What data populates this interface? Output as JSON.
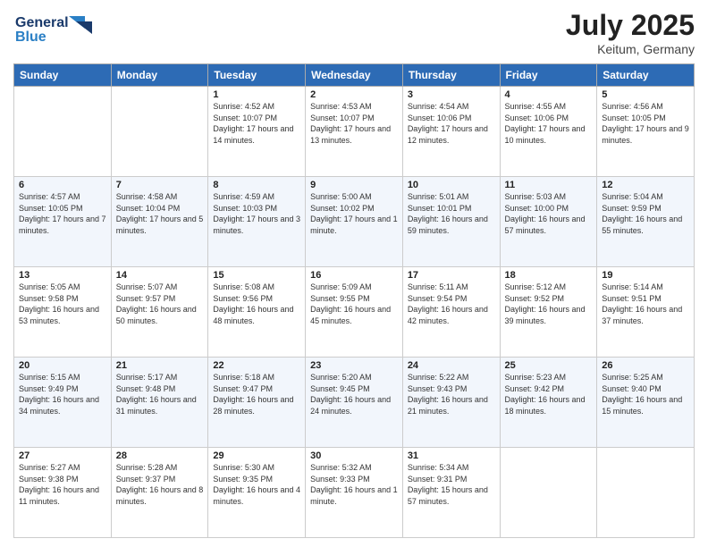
{
  "header": {
    "logo_line1": "General",
    "logo_line2": "Blue",
    "month": "July 2025",
    "location": "Keitum, Germany"
  },
  "weekdays": [
    "Sunday",
    "Monday",
    "Tuesday",
    "Wednesday",
    "Thursday",
    "Friday",
    "Saturday"
  ],
  "weeks": [
    [
      {
        "day": "",
        "sunrise": "",
        "sunset": "",
        "daylight": ""
      },
      {
        "day": "",
        "sunrise": "",
        "sunset": "",
        "daylight": ""
      },
      {
        "day": "1",
        "sunrise": "Sunrise: 4:52 AM",
        "sunset": "Sunset: 10:07 PM",
        "daylight": "Daylight: 17 hours and 14 minutes."
      },
      {
        "day": "2",
        "sunrise": "Sunrise: 4:53 AM",
        "sunset": "Sunset: 10:07 PM",
        "daylight": "Daylight: 17 hours and 13 minutes."
      },
      {
        "day": "3",
        "sunrise": "Sunrise: 4:54 AM",
        "sunset": "Sunset: 10:06 PM",
        "daylight": "Daylight: 17 hours and 12 minutes."
      },
      {
        "day": "4",
        "sunrise": "Sunrise: 4:55 AM",
        "sunset": "Sunset: 10:06 PM",
        "daylight": "Daylight: 17 hours and 10 minutes."
      },
      {
        "day": "5",
        "sunrise": "Sunrise: 4:56 AM",
        "sunset": "Sunset: 10:05 PM",
        "daylight": "Daylight: 17 hours and 9 minutes."
      }
    ],
    [
      {
        "day": "6",
        "sunrise": "Sunrise: 4:57 AM",
        "sunset": "Sunset: 10:05 PM",
        "daylight": "Daylight: 17 hours and 7 minutes."
      },
      {
        "day": "7",
        "sunrise": "Sunrise: 4:58 AM",
        "sunset": "Sunset: 10:04 PM",
        "daylight": "Daylight: 17 hours and 5 minutes."
      },
      {
        "day": "8",
        "sunrise": "Sunrise: 4:59 AM",
        "sunset": "Sunset: 10:03 PM",
        "daylight": "Daylight: 17 hours and 3 minutes."
      },
      {
        "day": "9",
        "sunrise": "Sunrise: 5:00 AM",
        "sunset": "Sunset: 10:02 PM",
        "daylight": "Daylight: 17 hours and 1 minute."
      },
      {
        "day": "10",
        "sunrise": "Sunrise: 5:01 AM",
        "sunset": "Sunset: 10:01 PM",
        "daylight": "Daylight: 16 hours and 59 minutes."
      },
      {
        "day": "11",
        "sunrise": "Sunrise: 5:03 AM",
        "sunset": "Sunset: 10:00 PM",
        "daylight": "Daylight: 16 hours and 57 minutes."
      },
      {
        "day": "12",
        "sunrise": "Sunrise: 5:04 AM",
        "sunset": "Sunset: 9:59 PM",
        "daylight": "Daylight: 16 hours and 55 minutes."
      }
    ],
    [
      {
        "day": "13",
        "sunrise": "Sunrise: 5:05 AM",
        "sunset": "Sunset: 9:58 PM",
        "daylight": "Daylight: 16 hours and 53 minutes."
      },
      {
        "day": "14",
        "sunrise": "Sunrise: 5:07 AM",
        "sunset": "Sunset: 9:57 PM",
        "daylight": "Daylight: 16 hours and 50 minutes."
      },
      {
        "day": "15",
        "sunrise": "Sunrise: 5:08 AM",
        "sunset": "Sunset: 9:56 PM",
        "daylight": "Daylight: 16 hours and 48 minutes."
      },
      {
        "day": "16",
        "sunrise": "Sunrise: 5:09 AM",
        "sunset": "Sunset: 9:55 PM",
        "daylight": "Daylight: 16 hours and 45 minutes."
      },
      {
        "day": "17",
        "sunrise": "Sunrise: 5:11 AM",
        "sunset": "Sunset: 9:54 PM",
        "daylight": "Daylight: 16 hours and 42 minutes."
      },
      {
        "day": "18",
        "sunrise": "Sunrise: 5:12 AM",
        "sunset": "Sunset: 9:52 PM",
        "daylight": "Daylight: 16 hours and 39 minutes."
      },
      {
        "day": "19",
        "sunrise": "Sunrise: 5:14 AM",
        "sunset": "Sunset: 9:51 PM",
        "daylight": "Daylight: 16 hours and 37 minutes."
      }
    ],
    [
      {
        "day": "20",
        "sunrise": "Sunrise: 5:15 AM",
        "sunset": "Sunset: 9:49 PM",
        "daylight": "Daylight: 16 hours and 34 minutes."
      },
      {
        "day": "21",
        "sunrise": "Sunrise: 5:17 AM",
        "sunset": "Sunset: 9:48 PM",
        "daylight": "Daylight: 16 hours and 31 minutes."
      },
      {
        "day": "22",
        "sunrise": "Sunrise: 5:18 AM",
        "sunset": "Sunset: 9:47 PM",
        "daylight": "Daylight: 16 hours and 28 minutes."
      },
      {
        "day": "23",
        "sunrise": "Sunrise: 5:20 AM",
        "sunset": "Sunset: 9:45 PM",
        "daylight": "Daylight: 16 hours and 24 minutes."
      },
      {
        "day": "24",
        "sunrise": "Sunrise: 5:22 AM",
        "sunset": "Sunset: 9:43 PM",
        "daylight": "Daylight: 16 hours and 21 minutes."
      },
      {
        "day": "25",
        "sunrise": "Sunrise: 5:23 AM",
        "sunset": "Sunset: 9:42 PM",
        "daylight": "Daylight: 16 hours and 18 minutes."
      },
      {
        "day": "26",
        "sunrise": "Sunrise: 5:25 AM",
        "sunset": "Sunset: 9:40 PM",
        "daylight": "Daylight: 16 hours and 15 minutes."
      }
    ],
    [
      {
        "day": "27",
        "sunrise": "Sunrise: 5:27 AM",
        "sunset": "Sunset: 9:38 PM",
        "daylight": "Daylight: 16 hours and 11 minutes."
      },
      {
        "day": "28",
        "sunrise": "Sunrise: 5:28 AM",
        "sunset": "Sunset: 9:37 PM",
        "daylight": "Daylight: 16 hours and 8 minutes."
      },
      {
        "day": "29",
        "sunrise": "Sunrise: 5:30 AM",
        "sunset": "Sunset: 9:35 PM",
        "daylight": "Daylight: 16 hours and 4 minutes."
      },
      {
        "day": "30",
        "sunrise": "Sunrise: 5:32 AM",
        "sunset": "Sunset: 9:33 PM",
        "daylight": "Daylight: 16 hours and 1 minute."
      },
      {
        "day": "31",
        "sunrise": "Sunrise: 5:34 AM",
        "sunset": "Sunset: 9:31 PM",
        "daylight": "Daylight: 15 hours and 57 minutes."
      },
      {
        "day": "",
        "sunrise": "",
        "sunset": "",
        "daylight": ""
      },
      {
        "day": "",
        "sunrise": "",
        "sunset": "",
        "daylight": ""
      }
    ]
  ]
}
